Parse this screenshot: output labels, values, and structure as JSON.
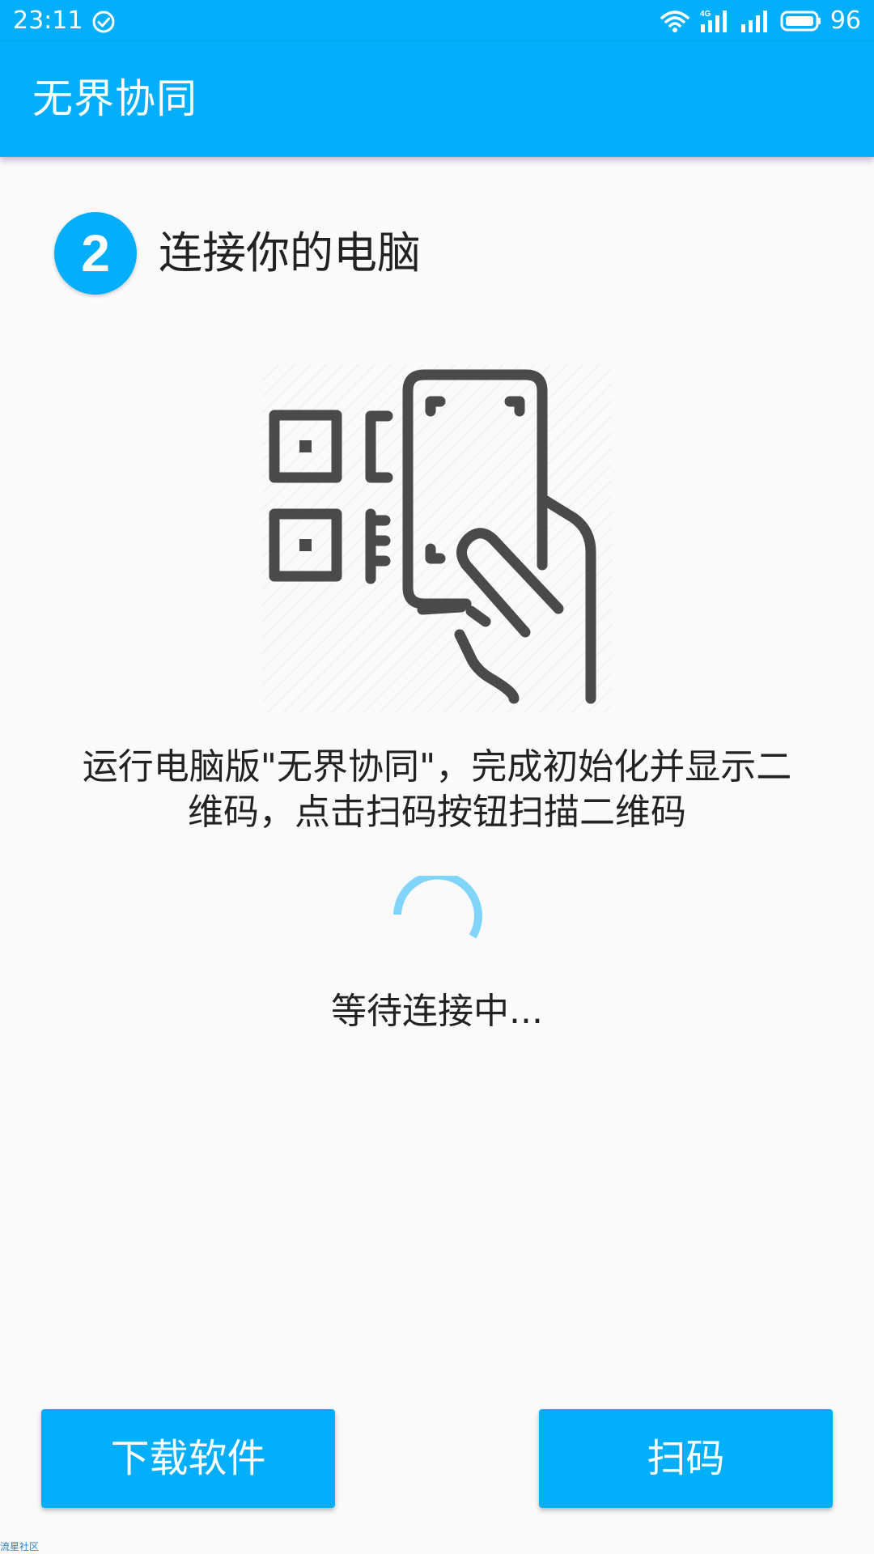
{
  "status_bar": {
    "time": "23:11",
    "check_icon": "check-circle-icon",
    "network_label": "4G",
    "battery_percent": "96"
  },
  "app_bar": {
    "title": "无界协同"
  },
  "step": {
    "number": "2",
    "title": "连接你的电脑"
  },
  "illustration": {
    "icon": "scan-qr-code-with-phone-icon"
  },
  "instruction": {
    "line1": "运行电脑版\"无界协同\"，完成初始化并显示二",
    "line2": "维码，点击扫码按钮扫描二维码"
  },
  "status": {
    "waiting_text": "等待连接中..."
  },
  "buttons": {
    "download_label": "下载软件",
    "scan_label": "扫码"
  },
  "watermark": {
    "text": "流星社区"
  },
  "colors": {
    "primary": "#03aefb",
    "spinner": "#81d4fa",
    "text": "#222222",
    "background": "#fafafa",
    "icon": "#4a4a4a"
  }
}
